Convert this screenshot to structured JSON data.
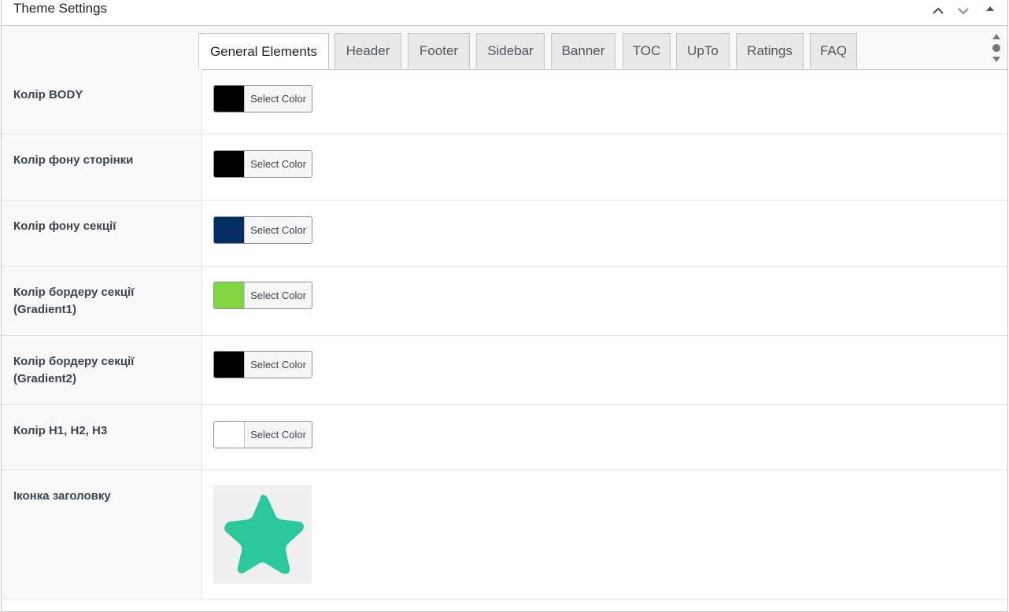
{
  "panel": {
    "title": "Theme Settings"
  },
  "tabs": [
    {
      "label": "General Elements",
      "active": true
    },
    {
      "label": "Header"
    },
    {
      "label": "Footer"
    },
    {
      "label": "Sidebar"
    },
    {
      "label": "Banner"
    },
    {
      "label": "TOC"
    },
    {
      "label": "UpTo"
    },
    {
      "label": "Ratings"
    },
    {
      "label": "FAQ"
    }
  ],
  "rows": [
    {
      "label": "Колір BODY",
      "button": "Select Color",
      "color": "#000000"
    },
    {
      "label": "Колір фону сторінки",
      "button": "Select Color",
      "color": "#000000"
    },
    {
      "label": "Колір фону секції",
      "button": "Select Color",
      "color": "#012d60"
    },
    {
      "label": "Колір бордеру секції (Gradient1)",
      "button": "Select Color",
      "color": "#81d742"
    },
    {
      "label": "Колір бордеру секції (Gradient2)",
      "button": "Select Color",
      "color": "#000000"
    },
    {
      "label": "Колір H1, H2, H3",
      "button": "Select Color",
      "color": "#ffffff"
    },
    {
      "label": "Іконка заголовку",
      "icon": "star-icon",
      "icon_color": "#2cc89d"
    }
  ]
}
